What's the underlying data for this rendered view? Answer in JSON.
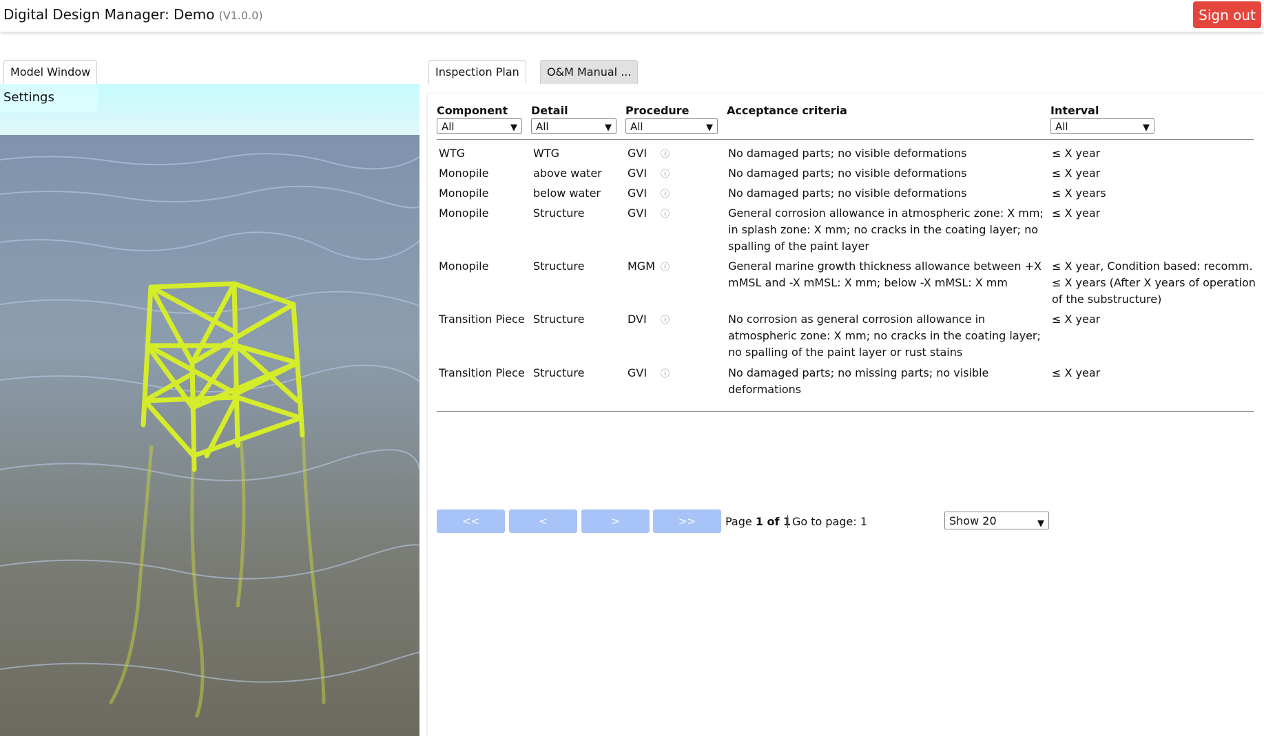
{
  "header": {
    "title": "Digital Design Manager: Demo",
    "version": "(V1.0.0)",
    "sign_out": "Sign out"
  },
  "left_panel": {
    "tab": "Model Window",
    "settings": "Settings"
  },
  "right_panel": {
    "tabs": [
      "Inspection Plan",
      "O&M Manual ..."
    ],
    "columns": {
      "component": "Component",
      "detail": "Detail",
      "procedure": "Procedure",
      "acceptance": "Acceptance criteria",
      "interval": "Interval"
    },
    "filters": {
      "component": "All",
      "detail": "All",
      "procedure": "All",
      "interval": "All"
    },
    "rows": [
      {
        "component": "WTG",
        "detail": "WTG",
        "procedure": "GVI",
        "acceptance": "No damaged parts; no visible deformations",
        "interval": "≤ X year"
      },
      {
        "component": "Monopile",
        "detail": "above water",
        "procedure": "GVI",
        "acceptance": "No damaged parts; no visible deformations",
        "interval": "≤ X year"
      },
      {
        "component": "Monopile",
        "detail": "below water",
        "procedure": "GVI",
        "acceptance": "No damaged parts; no visible deformations",
        "interval": "≤ X years"
      },
      {
        "component": "Monopile",
        "detail": "Structure",
        "procedure": "GVI",
        "acceptance": "General corrosion allowance in atmospheric zone: X mm; in splash zone: X mm; no cracks in the coating layer; no spalling of the paint layer",
        "interval": "≤ X year"
      },
      {
        "component": "Monopile",
        "detail": "Structure",
        "procedure": "MGM",
        "acceptance": "General marine growth thickness allowance between +X mMSL and -X mMSL: X mm; below -X mMSL: X mm",
        "interval": "≤ X year, Condition based: recomm. ≤ X years (After X years of operation of the substructure)"
      },
      {
        "component": "Transition Piece",
        "detail": "Structure",
        "procedure": "DVI",
        "acceptance": "No corrosion as general corrosion allowance in atmospheric zone: X mm; no cracks in the coating layer; no spalling of the paint layer or rust stains",
        "interval": "≤ X year"
      },
      {
        "component": "Transition Piece",
        "detail": "Structure",
        "procedure": "GVI",
        "acceptance": "No damaged parts; no missing parts; no visible deformations",
        "interval": "≤ X year"
      }
    ],
    "pagination": {
      "first": "<<",
      "prev": "<",
      "next": ">",
      "last": ">>",
      "page_prefix": "Page",
      "page_current": "1 of 1",
      "goto_label": "Go to page: 1",
      "show": "Show 20"
    },
    "icons": {
      "info": "info-circle-icon",
      "dropdown": "chevron-down-icon"
    },
    "colors": {
      "sign_out": "#e5453d",
      "pager_button": "#a7c3f7",
      "jacket": "#d4ec2a"
    }
  }
}
